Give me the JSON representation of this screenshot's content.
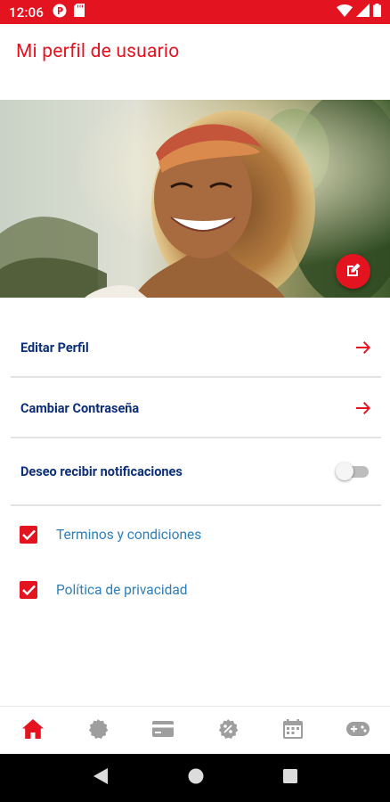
{
  "status_bar": {
    "time": "12:06",
    "left_icons": [
      "p-app-icon",
      "sd-card-icon"
    ],
    "right_icons": [
      "wifi-icon",
      "signal-icon",
      "battery-icon"
    ],
    "background": "#e3141f"
  },
  "header": {
    "title": "Mi perfil de usuario"
  },
  "profile_photo": {
    "alt": "profile-photo",
    "edit_icon": "edit-icon"
  },
  "menu": {
    "edit_profile": "Editar Perfil",
    "change_password": "Cambiar Contraseña",
    "notifications": "Deseo recibir notificaciones",
    "notifications_enabled": false
  },
  "checkboxes": {
    "terms": {
      "label": "Terminos y condiciones",
      "checked": true
    },
    "privacy": {
      "label": "Política de privacidad",
      "checked": true
    }
  },
  "bottom_nav": {
    "items": [
      "home-icon",
      "badge-icon",
      "card-icon",
      "discount-icon",
      "calendar-icon",
      "gamepad-icon"
    ],
    "active": "home-icon"
  },
  "system_nav": [
    "back-icon",
    "home-circle-icon",
    "recents-icon"
  ],
  "colors": {
    "accent": "#e3141f",
    "navy": "#0b2f7a",
    "link_blue": "#2f7fbd",
    "icon_gray": "#9e9e9e"
  }
}
